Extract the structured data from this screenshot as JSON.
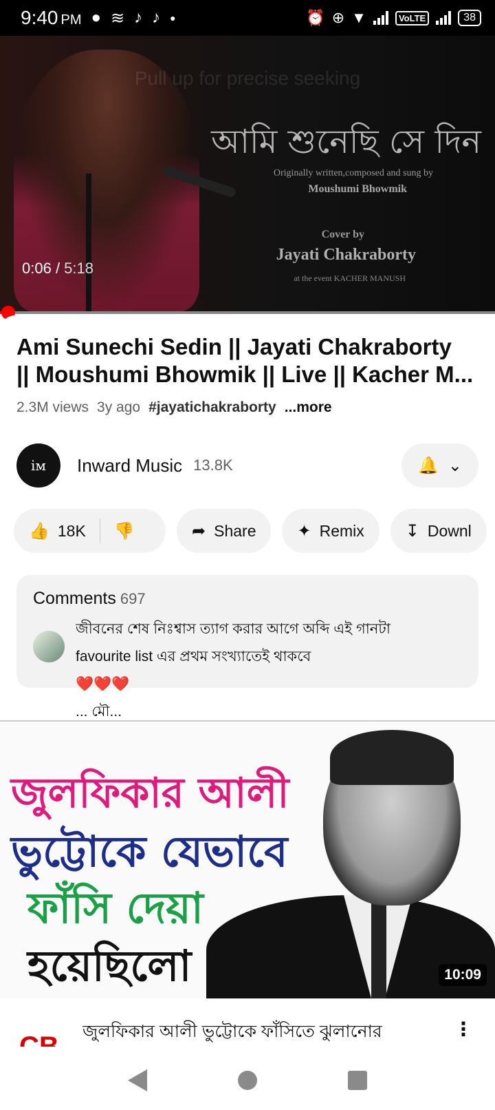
{
  "status_bar": {
    "time": "9:40",
    "ampm": "PM",
    "left_icons": [
      "chat-bubble-icon",
      "wave-icon",
      "tiktok-icon",
      "tiktok-icon"
    ],
    "volte": "VoLTE",
    "battery": "38"
  },
  "player": {
    "seek_hint": "Pull up for precise seeking",
    "overlay_title": "আমি শুনেছি সে দিন",
    "credit_line1": "Originally written,composed and sung by",
    "credit_line2": "Moushumi Bhowmik",
    "credit_line3": "Cover by",
    "credit_line4": "Jayati Chakraborty",
    "credit_line5": "at the event KACHER MANUSH",
    "current_time": "0:06",
    "duration": "5:18",
    "progress_fraction": 0.019
  },
  "video": {
    "title_line1": "Ami Sunechi Sedin || Jayati Chakraborty",
    "title_line2": "|| Moushumi Bhowmik || Live || Kacher M...",
    "views": "2.3M views",
    "age": "3y ago",
    "hashtag": "#jayatichakraborty",
    "more": "...more"
  },
  "channel": {
    "name": "Inward Music",
    "subscribers": "13.8K",
    "avatar_text": "iм"
  },
  "actions": {
    "likes": "18K",
    "share": "Share",
    "remix": "Remix",
    "download": "Downl"
  },
  "comments": {
    "label": "Comments",
    "count": "697",
    "top_comment_line1": "জীবনের শেষ নিঃশ্বাস ত্যাগ করার আগে অব্দি এই গানটা",
    "top_comment_line2": "favourite list এর প্রথম সংখ্যাতেই থাকবে",
    "top_comment_hearts": "❤️❤️❤️",
    "top_comment_tail": "... মৌ..."
  },
  "next_video": {
    "thumb_line1": "জুলফিকার আলী",
    "thumb_line2": "ভুট্টোকে যেভাবে",
    "thumb_line3": "ফাঁসি দেয়া",
    "thumb_line4": "হয়েছিলো",
    "duration": "10:09",
    "channel_logo": "CB",
    "title": "জুলফিকার আলী ভুট্টোকে ফাঁসিতে ঝুলানোর"
  }
}
